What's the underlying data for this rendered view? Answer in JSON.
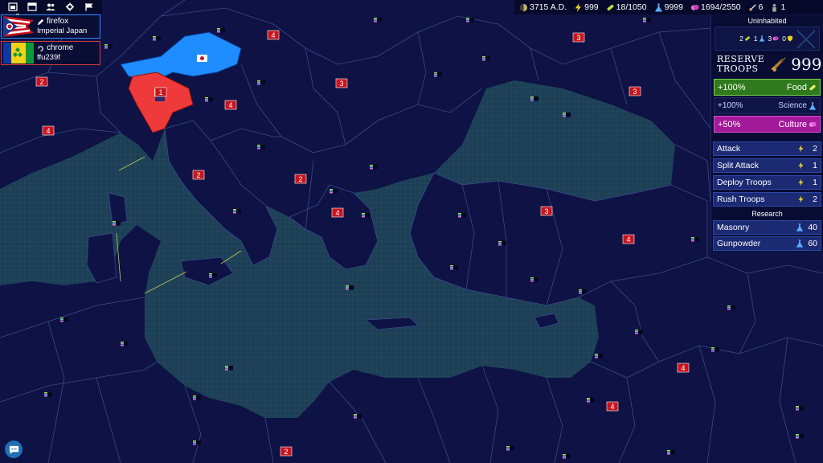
{
  "toolbar": {
    "icons": [
      "window-icon",
      "chat-window-icon",
      "people-icon",
      "gear-icon",
      "flag-icon"
    ]
  },
  "players": [
    {
      "name": "firefox",
      "subtitle": "Imperial Japan",
      "border_color": "#2d8cff",
      "icon": "pen-icon"
    },
    {
      "name": "chrome",
      "subtitle": "ffu239f",
      "border_color": "#d63a3a",
      "icon": "spinner-icon"
    }
  ],
  "resources": {
    "date": "3715 A.D.",
    "energy": "999",
    "food": "18/1050",
    "science": "9999",
    "culture": "1694/2550",
    "swords": "6",
    "troops": "1"
  },
  "panel": {
    "uninhabited_title": "Uninhabited",
    "uninhabited_food": "2",
    "uninhabited_science": "1",
    "uninhabited_culture": "3",
    "uninhabited_defense": "0",
    "reserve_label_1": "Reserve",
    "reserve_label_2": "Troops",
    "reserve_value": "999",
    "food_bonus": "+100%",
    "food_label": "Food",
    "science_bonus": "+100%",
    "science_label": "Science",
    "culture_bonus": "+50%",
    "culture_label": "Culture",
    "actions": [
      {
        "label": "Attack",
        "cost": "2"
      },
      {
        "label": "Split Attack",
        "cost": "1"
      },
      {
        "label": "Deploy Troops",
        "cost": "1"
      },
      {
        "label": "Rush Troops",
        "cost": "2"
      }
    ],
    "research_title": "Research",
    "research": [
      {
        "label": "Masonry",
        "cost": "40"
      },
      {
        "label": "Gunpowder",
        "cost": "60"
      }
    ]
  },
  "map_markers": {
    "troop_counts": [
      "4",
      "2",
      "3",
      "4",
      "3",
      "1",
      "4",
      "2",
      "2",
      "4",
      "3",
      "4",
      "4",
      "4",
      "2",
      "3"
    ]
  },
  "colors": {
    "background": "#0f1448",
    "sea": "#1c3f55",
    "land": "#0e1245",
    "borders": "#3a4a8a",
    "player_blue": "#1f8cff",
    "player_red": "#ee3a3a",
    "troop_badge": "#c8141e"
  }
}
